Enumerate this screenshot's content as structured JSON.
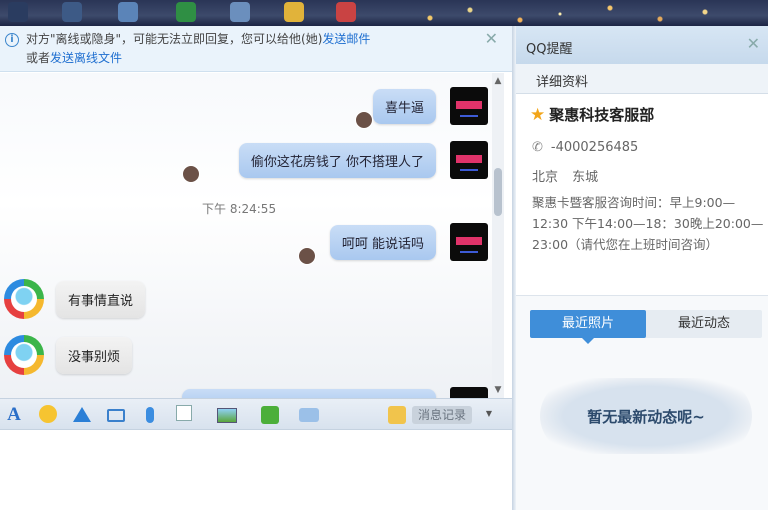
{
  "notice": {
    "line1": "对方\"离线或隐身\"，可能无法立即回复，您可以给他(她)",
    "link1": "发送邮件",
    "line2": "或者",
    "link2": "发送离线文件"
  },
  "messages": [
    {
      "dir": "out",
      "text": "喜牛逼"
    },
    {
      "dir": "out",
      "text": "偷你这花房钱了 你不搭理人了"
    },
    {
      "dir": "time",
      "text": "下午 8:24:55"
    },
    {
      "dir": "out",
      "text": "呵呵 能说话吗"
    },
    {
      "dir": "in",
      "text": "有事情直说"
    },
    {
      "dir": "in",
      "text": "没事别烦"
    }
  ],
  "toolbar": {
    "font_icon_label": "A",
    "history_label": "消息记录"
  },
  "side": {
    "title": "QQ提醒",
    "tab_label": "详细资料",
    "name": "聚惠科技客服部",
    "phone": "-4000256485",
    "location": "北京 东城",
    "description": "聚惠卡暨客服咨询时间：早上9:00—12:30 下午14:00—18：30晚上20:00—23:00（请代您在上班时间咨询）",
    "tabs": [
      "最近照片",
      "最近动态"
    ],
    "empty_text": "暂无最新动态呢~"
  },
  "colors": {
    "accent": "#3f8ed9",
    "out_bubble": "#a9c8ef",
    "in_bubble": "#e4e4e4",
    "link": "#1f6fd0"
  }
}
